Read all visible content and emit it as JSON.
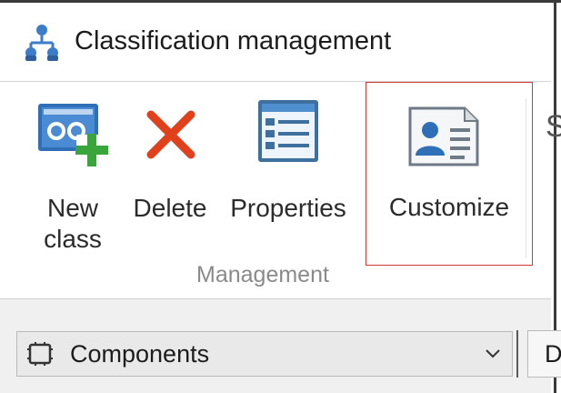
{
  "window": {
    "title": "Classification management",
    "icon": "org-chart-icon"
  },
  "ribbon": {
    "buttons": [
      {
        "id": "new_class",
        "label": "New\nclass",
        "icon": "new-class-icon"
      },
      {
        "id": "delete",
        "label": "Delete",
        "icon": "delete-x-icon"
      },
      {
        "id": "properties",
        "label": "Properties",
        "icon": "properties-icon"
      },
      {
        "id": "customize",
        "label": "Customize",
        "icon": "customize-card-icon",
        "highlighted": true
      }
    ],
    "group_label": "Management",
    "next_group_glyph": "S"
  },
  "toolbar": {
    "combo_value": "Components",
    "combo_icon": "component-icon",
    "tab_stub_text": "D"
  },
  "colors": {
    "highlight_border": "#d23a3a",
    "delete_red": "#e0401c",
    "add_green": "#3aa53a",
    "icon_blue": "#2e6fb7"
  }
}
